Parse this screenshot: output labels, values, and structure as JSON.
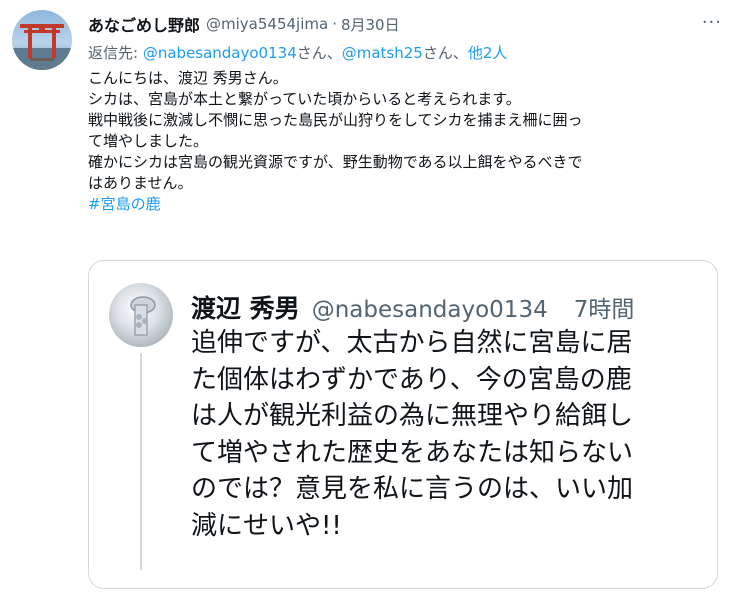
{
  "tweet": {
    "display_name": "あなごめし野郎",
    "handle": "@miya5454jima",
    "separator": "·",
    "date": "8月30日",
    "more_glyph": "···",
    "reply_to": {
      "prefix": "返信先: ",
      "user1": "@nabesandayo0134",
      "san1": "さん、",
      "user2": "@matsh25",
      "san2": "さん、",
      "others": "他2人"
    },
    "body_lines": [
      "こんにちは、渡辺 秀男さん。",
      "シカは、宮島が本土と繋がっていた頃からいると考えられます。",
      "戦中戦後に激減し不憫に思った島民が山狩りをしてシカを捕まえ柵に囲っ",
      "て増やしました。",
      "確かにシカは宮島の観光資源ですが、野生動物である以上餌をやるべきで",
      "はありません。"
    ],
    "hashtag": "#宮島の鹿"
  },
  "quoted": {
    "display_name": "渡辺 秀男",
    "handle": "@nabesandayo0134",
    "time": "7時間",
    "lines": [
      "追伸ですが、太古から自然に宮島に居",
      "た個体はわずかであり、今の宮島の鹿",
      "は人が観光利益の為に無理やり給餌し",
      "て増やされた歴史をあなたは知らない",
      "のでは？意見を私に言うのは、いい加",
      "減にせいや!!"
    ]
  },
  "colors": {
    "link": "#1d9bf0",
    "secondary_text": "#536471",
    "primary_text": "#0f1419",
    "border": "#cfd9de"
  }
}
